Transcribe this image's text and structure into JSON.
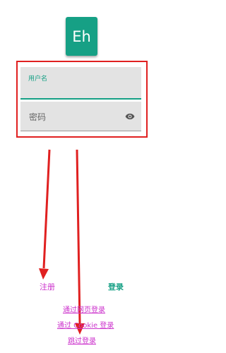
{
  "logo": {
    "text": "Eh",
    "color": "#16a085"
  },
  "form": {
    "username_label": "用户名",
    "password_placeholder": "密码",
    "visibility_icon": "eye-icon"
  },
  "actions": {
    "register_label": "注册",
    "login_label": "登录"
  },
  "alt_logins": {
    "web_login": "通过网页登录",
    "cookie_login": "通过 Cookie 登录",
    "skip_login": "跳过登录"
  },
  "colors": {
    "accent": "#16a085",
    "link": "#cc33cc",
    "field_bg": "#e3e3e3",
    "annotation": "#e02020"
  }
}
